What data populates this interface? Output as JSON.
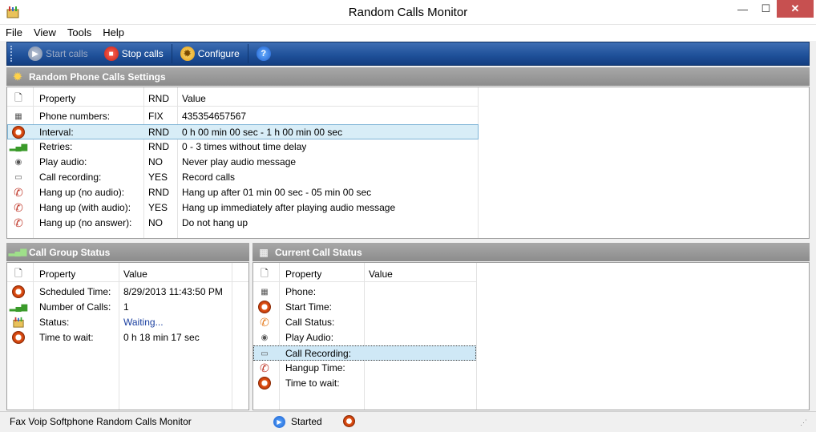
{
  "window": {
    "title": "Random Calls Monitor",
    "min_glyph": "—",
    "max_glyph": "☐",
    "close_glyph": "✕"
  },
  "menu": [
    "File",
    "View",
    "Tools",
    "Help"
  ],
  "toolbar": {
    "start_label": "Start calls",
    "stop_label": "Stop calls",
    "configure_label": "Configure",
    "help_glyph": "?"
  },
  "settings": {
    "title": "Random Phone Calls Settings",
    "columns": {
      "property": "Property",
      "rnd": "RND",
      "value": "Value"
    },
    "rows": [
      {
        "icon": "phone-book-icon",
        "property": "Phone numbers:",
        "rnd": "FIX",
        "value": "435354657567"
      },
      {
        "icon": "clock-icon",
        "property": "Interval:",
        "rnd": "RND",
        "value": "0 h 00 min 00 sec - 1 h 00 min 00 sec"
      },
      {
        "icon": "signal-bars-icon",
        "property": "Retries:",
        "rnd": "RND",
        "value": "0 - 3 times without time delay"
      },
      {
        "icon": "speaker-icon",
        "property": "Play audio:",
        "rnd": "NO",
        "value": "Never play audio message"
      },
      {
        "icon": "tape-icon",
        "property": "Call recording:",
        "rnd": "YES",
        "value": "Record calls"
      },
      {
        "icon": "hangup-icon",
        "property": "Hang up (no audio):",
        "rnd": "RND",
        "value": "Hang up after 01 min 00 sec - 05 min 00 sec"
      },
      {
        "icon": "hangup-audio-icon",
        "property": "Hang up (with audio):",
        "rnd": "YES",
        "value": "Hang up immediately after playing audio message"
      },
      {
        "icon": "hangup-icon",
        "property": "Hang up (no answer):",
        "rnd": "NO",
        "value": "Do not hang up"
      }
    ]
  },
  "group_status": {
    "title": "Call Group Status",
    "columns": {
      "property": "Property",
      "value": "Value"
    },
    "rows": [
      {
        "icon": "clock-icon",
        "property": "Scheduled Time:",
        "value": "8/29/2013 11:43:50 PM"
      },
      {
        "icon": "signal-bars-icon",
        "property": "Number of Calls:",
        "value": "1"
      },
      {
        "icon": "app-icon",
        "property": "Status:",
        "value": "Waiting..."
      },
      {
        "icon": "clock-icon",
        "property": "Time to wait:",
        "value": "0 h 18 min 17 sec"
      }
    ]
  },
  "current_status": {
    "title": "Current Call Status",
    "columns": {
      "property": "Property",
      "value": "Value"
    },
    "rows": [
      {
        "icon": "phone-book-icon",
        "property": "Phone:",
        "value": ""
      },
      {
        "icon": "clock-icon",
        "property": "Start Time:",
        "value": ""
      },
      {
        "icon": "phone-orange-icon",
        "property": "Call Status:",
        "value": ""
      },
      {
        "icon": "speaker-icon",
        "property": "Play Audio:",
        "value": ""
      },
      {
        "icon": "tape-icon",
        "property": "Call Recording:",
        "value": ""
      },
      {
        "icon": "hangup-icon",
        "property": "Hangup Time:",
        "value": ""
      },
      {
        "icon": "clock-icon",
        "property": "Time to wait:",
        "value": ""
      }
    ]
  },
  "statusbar": {
    "app_text": "Fax Voip Softphone Random Calls Monitor",
    "state_text": "Started"
  },
  "colors": {
    "toolbar": "#1e4f98",
    "section_header": "#9a9a9a",
    "selection": "#d8edf7",
    "close_button": "#c75050"
  }
}
